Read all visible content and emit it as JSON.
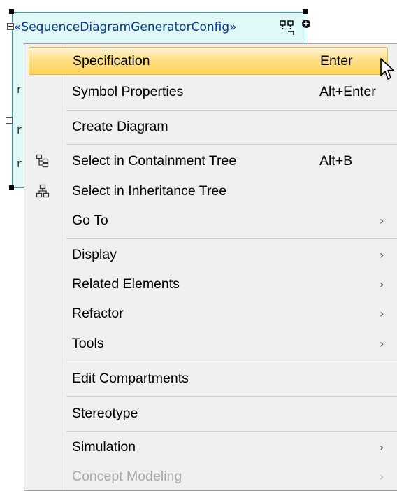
{
  "diagram": {
    "stereotype_title": "«SequenceDiagramGeneratorConfig»",
    "compartment_letter": "r"
  },
  "context_menu": {
    "items": [
      {
        "label": "Specification",
        "shortcut": "Enter",
        "submenu": false,
        "highlighted": true,
        "icon": ""
      },
      {
        "label": "Symbol Properties",
        "shortcut": "Alt+Enter",
        "submenu": false,
        "icon": ""
      },
      {
        "label": "Create Diagram",
        "shortcut": "",
        "submenu": false,
        "icon": ""
      },
      {
        "label": "Select in Containment Tree",
        "shortcut": "Alt+B",
        "submenu": false,
        "icon": "containment-tree-icon"
      },
      {
        "label": "Select in Inheritance Tree",
        "shortcut": "",
        "submenu": false,
        "icon": "inheritance-tree-icon"
      },
      {
        "label": "Go To",
        "shortcut": "",
        "submenu": true,
        "icon": ""
      },
      {
        "label": "Display",
        "shortcut": "",
        "submenu": true,
        "icon": ""
      },
      {
        "label": "Related Elements",
        "shortcut": "",
        "submenu": true,
        "icon": ""
      },
      {
        "label": "Refactor",
        "shortcut": "",
        "submenu": true,
        "icon": ""
      },
      {
        "label": "Tools",
        "shortcut": "",
        "submenu": true,
        "icon": ""
      },
      {
        "label": "Edit Compartments",
        "shortcut": "",
        "submenu": false,
        "icon": ""
      },
      {
        "label": "Stereotype",
        "shortcut": "",
        "submenu": false,
        "icon": ""
      },
      {
        "label": "Simulation",
        "shortcut": "",
        "submenu": true,
        "icon": ""
      },
      {
        "label": "Concept Modeling",
        "shortcut": "",
        "submenu": true,
        "disabled": true,
        "icon": ""
      }
    ],
    "submenu_arrow": "›"
  },
  "colors": {
    "highlight_top": "#fff6d8",
    "highlight_bottom": "#ffd35a",
    "highlight_border": "#e9b33d",
    "menu_bg": "#f0f0f0",
    "shape_fill": "#dff8f8",
    "disabled_text": "#a8a8a8"
  }
}
